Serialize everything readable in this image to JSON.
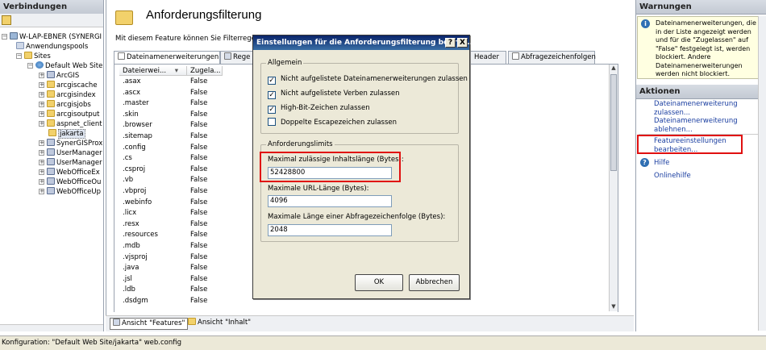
{
  "connections": {
    "title": "Verbindungen",
    "tree": [
      {
        "label": "W-LAP-EBNER (SYNERGI",
        "icon": "pc"
      },
      {
        "label": "Anwendungspools",
        "icon": "pool"
      },
      {
        "label": "Sites",
        "icon": "folder"
      },
      {
        "label": "Default Web Site",
        "icon": "globe"
      },
      {
        "label": "ArcGIS",
        "icon": "app"
      },
      {
        "label": "arcgiscache",
        "icon": "folder"
      },
      {
        "label": "arcgisindex",
        "icon": "folder"
      },
      {
        "label": "arcgisjobs",
        "icon": "folder"
      },
      {
        "label": "arcgisoutput",
        "icon": "folder"
      },
      {
        "label": "aspnet_client",
        "icon": "folder"
      },
      {
        "label": "jakarta",
        "icon": "folder"
      },
      {
        "label": "SynerGISProx",
        "icon": "app"
      },
      {
        "label": "UserManager",
        "icon": "app"
      },
      {
        "label": "UserManager",
        "icon": "app"
      },
      {
        "label": "WebOfficeEx",
        "icon": "app"
      },
      {
        "label": "WebOfficeOu",
        "icon": "app"
      },
      {
        "label": "WebOfficeUp",
        "icon": "app"
      }
    ]
  },
  "main": {
    "title": "Anforderungsfilterung",
    "description": "Mit diesem Feature können Sie Filterregeln k",
    "tabs": [
      {
        "label": "Dateinamenerweiterungen"
      },
      {
        "label": "Rege"
      },
      {
        "label": "Header"
      },
      {
        "label": "Abfragezeichenfolgen"
      }
    ],
    "columns": [
      "Dateierwei...",
      "Zugela..."
    ],
    "rows": [
      [
        ".asax",
        "False"
      ],
      [
        ".ascx",
        "False"
      ],
      [
        ".master",
        "False"
      ],
      [
        ".skin",
        "False"
      ],
      [
        ".browser",
        "False"
      ],
      [
        ".sitemap",
        "False"
      ],
      [
        ".config",
        "False"
      ],
      [
        ".cs",
        "False"
      ],
      [
        ".csproj",
        "False"
      ],
      [
        ".vb",
        "False"
      ],
      [
        ".vbproj",
        "False"
      ],
      [
        ".webinfo",
        "False"
      ],
      [
        ".licx",
        "False"
      ],
      [
        ".resx",
        "False"
      ],
      [
        ".resources",
        "False"
      ],
      [
        ".mdb",
        "False"
      ],
      [
        ".vjsproj",
        "False"
      ],
      [
        ".java",
        "False"
      ],
      [
        ".jsl",
        "False"
      ],
      [
        ".ldb",
        "False"
      ],
      [
        ".dsdgm",
        "False"
      ]
    ],
    "view_tabs": [
      "Ansicht \"Features\"",
      "Ansicht \"Inhalt\""
    ]
  },
  "dialog": {
    "title": "Einstellungen für die Anforderungsfilterung bearbe...",
    "help_btn": "?",
    "close_btn": "X",
    "general_group": "Allgemein",
    "checkboxes": [
      {
        "label": "Nicht aufgelistete Dateinamenerweiterungen zulassen",
        "checked": true
      },
      {
        "label": "Nicht aufgelistete Verben zulassen",
        "checked": true
      },
      {
        "label": "High-Bit-Zeichen zulassen",
        "checked": true
      },
      {
        "label": "Doppelte Escapezeichen zulassen",
        "checked": false
      }
    ],
    "limits_group": "Anforderungslimits",
    "fields": [
      {
        "label": "Maximal zulässige Inhaltslänge (Bytes):",
        "value": "52428800"
      },
      {
        "label": "Maximale URL-Länge (Bytes):",
        "value": "4096"
      },
      {
        "label": "Maximale Länge einer Abfragezeichenfolge (Bytes):",
        "value": "2048"
      }
    ],
    "ok": "OK",
    "cancel": "Abbrechen"
  },
  "right": {
    "warnings_title": "Warnungen",
    "warning_text": "Dateinamenerweiterungen, die in der Liste angezeigt werden und für die \"Zugelassen\" auf \"False\" festgelegt ist, werden blockiert. Andere Dateinamenerweiterungen werden nicht blockiert.",
    "actions_title": "Aktionen",
    "actions": [
      "Dateinamenerweiterung zulassen...",
      "Dateinamenerweiterung ablehnen...",
      "Featureeinstellungen bearbeiten...",
      "Hilfe",
      "Onlinehilfe"
    ]
  },
  "status": {
    "text": "Konfiguration: \"Default Web Site/jakarta\" web.config"
  },
  "colors": {
    "highlight": "#e01010",
    "link": "#1a3ea0",
    "titlebar": "#0a246a"
  }
}
